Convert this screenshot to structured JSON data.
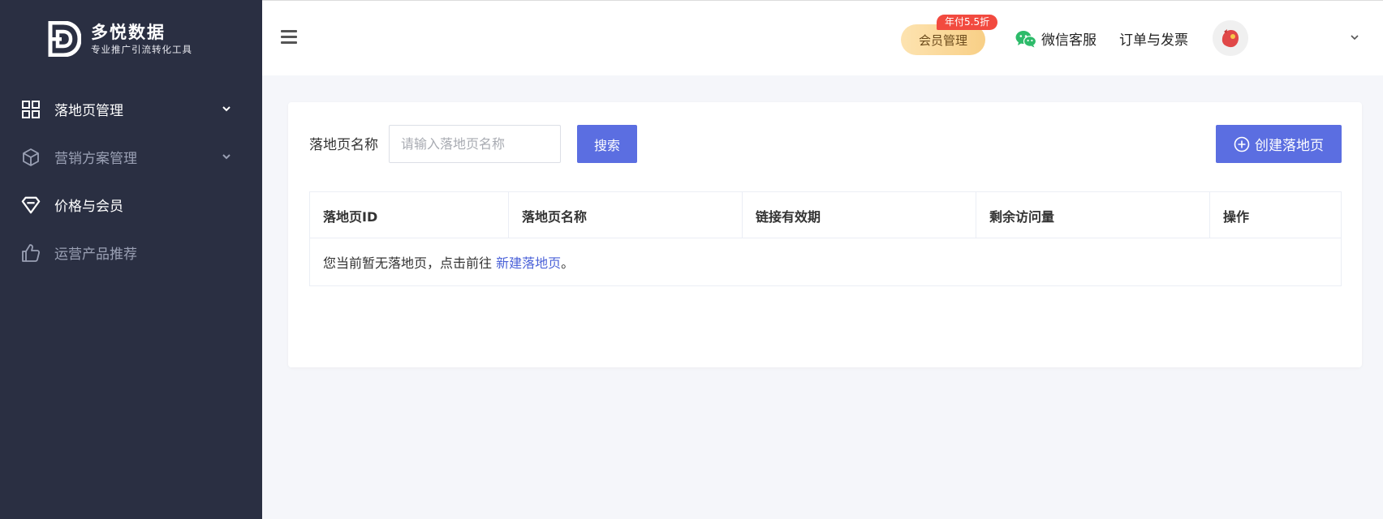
{
  "brand": {
    "title": "多悦数据",
    "subtitle": "专业推广引流转化工具"
  },
  "sidebar": {
    "items": [
      {
        "label": "落地页管理",
        "icon": "grid-icon",
        "has_chevron": true,
        "active": true
      },
      {
        "label": "营销方案管理",
        "icon": "box-icon",
        "has_chevron": true,
        "active": false
      },
      {
        "label": "价格与会员",
        "icon": "diamond-icon",
        "has_chevron": false,
        "active": true
      },
      {
        "label": "运营产品推荐",
        "icon": "thumbs-up-icon",
        "has_chevron": false,
        "active": false
      }
    ]
  },
  "header": {
    "vip_label": "会员管理",
    "vip_badge": "年付5.5折",
    "wechat_label": "微信客服",
    "orders_label": "订单与发票"
  },
  "search": {
    "label": "落地页名称",
    "placeholder": "请输入落地页名称",
    "value": "",
    "button": "搜索"
  },
  "create_button": "创建落地页",
  "table": {
    "columns": [
      "落地页ID",
      "落地页名称",
      "链接有效期",
      "剩余访问量",
      "操作"
    ],
    "empty_prefix": "您当前暂无落地页，点击前往 ",
    "empty_link": "新建落地页",
    "empty_suffix": "。"
  },
  "colors": {
    "sidebar_bg": "#2a2f42",
    "primary": "#5b6ee1",
    "badge": "#f24a3f",
    "wechat": "#2dbb6a"
  }
}
